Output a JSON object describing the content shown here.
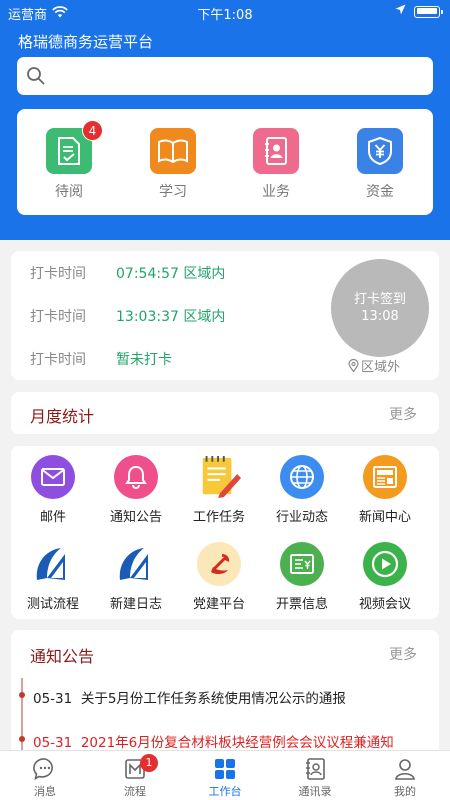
{
  "status_bar": {
    "carrier": "运营商",
    "time": "下午1:08"
  },
  "header": {
    "title": "格瑞德商务运营平台"
  },
  "search": {
    "placeholder": ""
  },
  "quick_actions": [
    {
      "label": "待阅",
      "icon": "document-check-icon",
      "color": "#3dbb73",
      "badge": "4"
    },
    {
      "label": "学习",
      "icon": "book-icon",
      "color": "#f08a1c"
    },
    {
      "label": "业务",
      "icon": "contact-book-icon",
      "color": "#ef6b8e"
    },
    {
      "label": "资金",
      "icon": "yen-shield-icon",
      "color": "#3b82e6"
    }
  ],
  "checkin": {
    "rows": [
      {
        "label": "打卡时间",
        "value": "07:54:57 区域内"
      },
      {
        "label": "打卡时间",
        "value": "13:03:37 区域内"
      },
      {
        "label": "打卡时间",
        "value": "暂未打卡"
      }
    ],
    "button_title": "打卡签到",
    "button_time": "13:08",
    "location_status": "区域外"
  },
  "monthly": {
    "title": "月度统计",
    "more": "更多"
  },
  "apps": [
    {
      "label": "邮件",
      "icon": "mail-icon",
      "color": "#8e4fe0"
    },
    {
      "label": "通知公告",
      "icon": "bell-icon",
      "color": "#ef4f8a"
    },
    {
      "label": "工作任务",
      "icon": "notepad-pencil-icon",
      "color": "#f7c93a"
    },
    {
      "label": "行业动态",
      "icon": "globe-icon",
      "color": "#3d8cf0"
    },
    {
      "label": "新闻中心",
      "icon": "newspaper-icon",
      "color": "#f29b1e"
    },
    {
      "label": "测试流程",
      "icon": "company-logo-icon",
      "color": "#1a5bb5"
    },
    {
      "label": "新建日志",
      "icon": "company-logo-icon",
      "color": "#1a5bb5"
    },
    {
      "label": "党建平台",
      "icon": "party-emblem-icon",
      "color": "#d42a1f"
    },
    {
      "label": "开票信息",
      "icon": "invoice-icon",
      "color": "#4caf50"
    },
    {
      "label": "视频会议",
      "icon": "play-icon",
      "color": "#3cb34a"
    }
  ],
  "notices": {
    "title": "通知公告",
    "more": "更多",
    "items": [
      {
        "date": "05-31",
        "text": "关于5月份工作任务系统使用情况公示的通报",
        "color": "#222222"
      },
      {
        "date": "05-31",
        "text": "2021年6月份复合材料板块经营例会会议议程兼通知",
        "color": "#e02020"
      }
    ]
  },
  "tabs": [
    {
      "label": "消息",
      "icon": "chat-icon"
    },
    {
      "label": "流程",
      "icon": "workflow-icon",
      "badge": "1"
    },
    {
      "label": "工作台",
      "icon": "grid-icon",
      "active": true
    },
    {
      "label": "通讯录",
      "icon": "address-book-icon"
    },
    {
      "label": "我的",
      "icon": "person-icon"
    }
  ]
}
